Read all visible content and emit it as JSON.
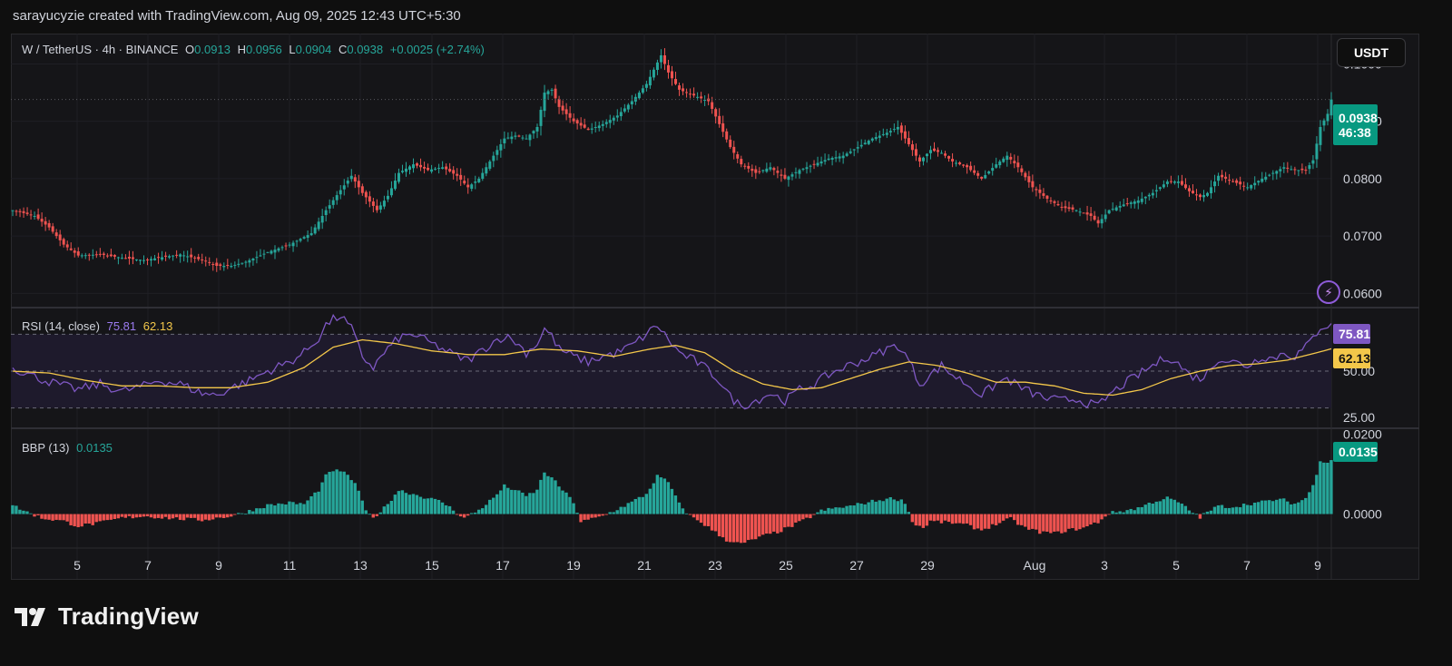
{
  "attribution": "sarayucyzie created with TradingView.com, Aug 09, 2025 12:43 UTC+5:30",
  "brand": "TradingView",
  "currency_button": "USDT",
  "flash_icon": "lightning-icon",
  "colors": {
    "up": "#26a69a",
    "down": "#ef5350",
    "rsi": "#7e57c2",
    "rsi_ma": "#f3c74a"
  },
  "legend": {
    "symbol": "W / TetherUS · 4h · BINANCE",
    "o_label": "O",
    "o": "0.0913",
    "h_label": "H",
    "h": "0.0956",
    "l_label": "L",
    "l": "0.0904",
    "c_label": "C",
    "c": "0.0938",
    "change": "+0.0025 (+2.74%)"
  },
  "price_tag": {
    "price": "0.0938",
    "countdown": "46:38"
  },
  "rsi_legend": {
    "label": "RSI (14, close)",
    "value": "75.81",
    "ma": "62.13"
  },
  "bbp_legend": {
    "label": "BBP (13)",
    "value": "0.0135"
  },
  "chart_data": [
    {
      "type": "candlestick",
      "series_name": "W / TetherUS",
      "x_ticks": [
        "5",
        "7",
        "9",
        "11",
        "13",
        "15",
        "17",
        "19",
        "21",
        "23",
        "25",
        "27",
        "29",
        "Aug",
        "3",
        "5",
        "7",
        "9"
      ],
      "y_ticks": [
        "0.1000",
        "0.0900",
        "0.0800",
        "0.0700",
        "0.0600"
      ],
      "ylim": [
        0.058,
        0.1045
      ],
      "last_price": 0.0938,
      "close_path": [
        [
          0,
          0.0745
        ],
        [
          6,
          0.0735
        ],
        [
          10,
          0.0715
        ],
        [
          14,
          0.0685
        ],
        [
          18,
          0.0666
        ],
        [
          24,
          0.0668
        ],
        [
          30,
          0.0662
        ],
        [
          36,
          0.0658
        ],
        [
          40,
          0.0662
        ],
        [
          46,
          0.0668
        ],
        [
          52,
          0.0658
        ],
        [
          56,
          0.0648
        ],
        [
          60,
          0.0648
        ],
        [
          64,
          0.0655
        ],
        [
          70,
          0.0672
        ],
        [
          76,
          0.0685
        ],
        [
          82,
          0.0705
        ],
        [
          86,
          0.0745
        ],
        [
          90,
          0.078
        ],
        [
          93,
          0.0805
        ],
        [
          96,
          0.0775
        ],
        [
          100,
          0.0745
        ],
        [
          103,
          0.077
        ],
        [
          106,
          0.081
        ],
        [
          110,
          0.0825
        ],
        [
          114,
          0.0815
        ],
        [
          118,
          0.082
        ],
        [
          122,
          0.0805
        ],
        [
          125,
          0.0785
        ],
        [
          128,
          0.08
        ],
        [
          132,
          0.084
        ],
        [
          135,
          0.087
        ],
        [
          138,
          0.0875
        ],
        [
          141,
          0.087
        ],
        [
          144,
          0.089
        ],
        [
          146,
          0.095
        ],
        [
          148,
          0.0955
        ],
        [
          150,
          0.0925
        ],
        [
          154,
          0.09
        ],
        [
          158,
          0.0885
        ],
        [
          162,
          0.0895
        ],
        [
          166,
          0.091
        ],
        [
          170,
          0.0935
        ],
        [
          174,
          0.0965
        ],
        [
          176,
          0.099
        ],
        [
          178,
          0.1015
        ],
        [
          180,
          0.0985
        ],
        [
          183,
          0.0955
        ],
        [
          187,
          0.0945
        ],
        [
          191,
          0.0935
        ],
        [
          194,
          0.0895
        ],
        [
          197,
          0.0855
        ],
        [
          200,
          0.0825
        ],
        [
          204,
          0.081
        ],
        [
          208,
          0.082
        ],
        [
          212,
          0.08
        ],
        [
          216,
          0.0815
        ],
        [
          220,
          0.0825
        ],
        [
          224,
          0.0835
        ],
        [
          228,
          0.084
        ],
        [
          232,
          0.0855
        ],
        [
          236,
          0.087
        ],
        [
          240,
          0.088
        ],
        [
          243,
          0.089
        ],
        [
          246,
          0.086
        ],
        [
          249,
          0.083
        ],
        [
          252,
          0.085
        ],
        [
          255,
          0.0845
        ],
        [
          258,
          0.083
        ],
        [
          262,
          0.082
        ],
        [
          266,
          0.08
        ],
        [
          270,
          0.0825
        ],
        [
          273,
          0.084
        ],
        [
          276,
          0.082
        ],
        [
          280,
          0.0785
        ],
        [
          284,
          0.0765
        ],
        [
          288,
          0.075
        ],
        [
          292,
          0.0745
        ],
        [
          296,
          0.0735
        ],
        [
          298,
          0.0722
        ],
        [
          301,
          0.0745
        ],
        [
          305,
          0.0755
        ],
        [
          309,
          0.0762
        ],
        [
          313,
          0.0775
        ],
        [
          317,
          0.0795
        ],
        [
          320,
          0.0795
        ],
        [
          323,
          0.0778
        ],
        [
          326,
          0.0768
        ],
        [
          328,
          0.0775
        ],
        [
          331,
          0.0805
        ],
        [
          335,
          0.0795
        ],
        [
          339,
          0.0785
        ],
        [
          343,
          0.08
        ],
        [
          346,
          0.081
        ],
        [
          349,
          0.082
        ],
        [
          352,
          0.0815
        ],
        [
          355,
          0.0815
        ],
        [
          357,
          0.0832
        ],
        [
          359,
          0.089
        ],
        [
          361,
          0.0913
        ],
        [
          362,
          0.0938
        ]
      ]
    },
    {
      "type": "line",
      "series_name": "RSI (14, close)",
      "ylim": [
        20,
        83
      ],
      "y_ticks": [
        "50.00",
        "25.00"
      ],
      "bands": [
        30,
        50,
        70
      ],
      "rsi_path": [
        [
          0,
          52
        ],
        [
          6,
          47
        ],
        [
          12,
          43
        ],
        [
          18,
          40
        ],
        [
          24,
          43
        ],
        [
          30,
          39
        ],
        [
          36,
          42
        ],
        [
          40,
          45
        ],
        [
          46,
          43
        ],
        [
          52,
          38
        ],
        [
          56,
          37
        ],
        [
          60,
          41
        ],
        [
          64,
          44
        ],
        [
          70,
          50
        ],
        [
          76,
          55
        ],
        [
          80,
          60
        ],
        [
          84,
          68
        ],
        [
          86,
          75
        ],
        [
          88,
          78
        ],
        [
          90,
          80
        ],
        [
          93,
          73
        ],
        [
          96,
          58
        ],
        [
          99,
          52
        ],
        [
          102,
          60
        ],
        [
          106,
          68
        ],
        [
          110,
          70
        ],
        [
          114,
          66
        ],
        [
          118,
          62
        ],
        [
          122,
          58
        ],
        [
          125,
          56
        ],
        [
          128,
          60
        ],
        [
          132,
          66
        ],
        [
          135,
          69
        ],
        [
          138,
          66
        ],
        [
          141,
          60
        ],
        [
          144,
          65
        ],
        [
          146,
          73
        ],
        [
          148,
          69
        ],
        [
          150,
          62
        ],
        [
          154,
          58
        ],
        [
          158,
          55
        ],
        [
          162,
          58
        ],
        [
          166,
          60
        ],
        [
          170,
          64
        ],
        [
          174,
          70
        ],
        [
          177,
          75
        ],
        [
          180,
          67
        ],
        [
          183,
          60
        ],
        [
          187,
          56
        ],
        [
          190,
          52
        ],
        [
          194,
          45
        ],
        [
          197,
          36
        ],
        [
          200,
          31
        ],
        [
          204,
          34
        ],
        [
          208,
          38
        ],
        [
          212,
          34
        ],
        [
          216,
          40
        ],
        [
          220,
          43
        ],
        [
          224,
          48
        ],
        [
          228,
          52
        ],
        [
          232,
          55
        ],
        [
          236,
          58
        ],
        [
          240,
          62
        ],
        [
          243,
          64
        ],
        [
          246,
          56
        ],
        [
          249,
          43
        ],
        [
          252,
          48
        ],
        [
          255,
          53
        ],
        [
          258,
          48
        ],
        [
          262,
          43
        ],
        [
          266,
          37
        ],
        [
          270,
          43
        ],
        [
          273,
          46
        ],
        [
          276,
          42
        ],
        [
          280,
          38
        ],
        [
          284,
          35
        ],
        [
          288,
          34
        ],
        [
          292,
          35
        ],
        [
          296,
          32
        ],
        [
          298,
          31
        ],
        [
          301,
          37
        ],
        [
          305,
          43
        ],
        [
          309,
          48
        ],
        [
          313,
          53
        ],
        [
          317,
          58
        ],
        [
          320,
          54
        ],
        [
          323,
          48
        ],
        [
          326,
          46
        ],
        [
          328,
          49
        ],
        [
          331,
          57
        ],
        [
          335,
          55
        ],
        [
          339,
          53
        ],
        [
          343,
          58
        ],
        [
          346,
          57
        ],
        [
          349,
          60
        ],
        [
          352,
          58
        ],
        [
          355,
          63
        ],
        [
          357,
          68
        ],
        [
          359,
          74
        ],
        [
          361,
          75
        ],
        [
          362,
          75.81
        ]
      ],
      "ma_path": [
        [
          0,
          50
        ],
        [
          10,
          49
        ],
        [
          20,
          45
        ],
        [
          30,
          42
        ],
        [
          40,
          42
        ],
        [
          50,
          41
        ],
        [
          60,
          41
        ],
        [
          70,
          44
        ],
        [
          80,
          52
        ],
        [
          88,
          63
        ],
        [
          96,
          67
        ],
        [
          105,
          65
        ],
        [
          115,
          61
        ],
        [
          125,
          59
        ],
        [
          135,
          59
        ],
        [
          145,
          62
        ],
        [
          155,
          61
        ],
        [
          165,
          58
        ],
        [
          175,
          62
        ],
        [
          182,
          64
        ],
        [
          190,
          60
        ],
        [
          198,
          50
        ],
        [
          206,
          43
        ],
        [
          214,
          40
        ],
        [
          222,
          41
        ],
        [
          230,
          46
        ],
        [
          238,
          51
        ],
        [
          246,
          55
        ],
        [
          254,
          53
        ],
        [
          262,
          49
        ],
        [
          270,
          44
        ],
        [
          278,
          44
        ],
        [
          286,
          42
        ],
        [
          294,
          38
        ],
        [
          302,
          37
        ],
        [
          310,
          40
        ],
        [
          318,
          46
        ],
        [
          326,
          50
        ],
        [
          334,
          53
        ],
        [
          342,
          54
        ],
        [
          350,
          56
        ],
        [
          358,
          60
        ],
        [
          362,
          62.13
        ]
      ]
    },
    {
      "type": "bar",
      "series_name": "BBP (13)",
      "ylim": [
        -0.0085,
        0.021
      ],
      "y_ticks": [
        "0.0200",
        "0.0000"
      ],
      "last_value": 0.0135,
      "bbp_path": [
        [
          0,
          0.0022
        ],
        [
          4,
          0.0005
        ],
        [
          8,
          -0.001
        ],
        [
          14,
          -0.0018
        ],
        [
          18,
          -0.003
        ],
        [
          24,
          -0.0022
        ],
        [
          30,
          -0.001
        ],
        [
          36,
          -0.0005
        ],
        [
          40,
          -0.0008
        ],
        [
          46,
          -0.0012
        ],
        [
          52,
          -0.0015
        ],
        [
          56,
          -0.001
        ],
        [
          60,
          -0.0005
        ],
        [
          64,
          0.0005
        ],
        [
          70,
          0.0022
        ],
        [
          76,
          0.0028
        ],
        [
          80,
          0.0025
        ],
        [
          84,
          0.006
        ],
        [
          86,
          0.0095
        ],
        [
          88,
          0.011
        ],
        [
          92,
          0.01
        ],
        [
          95,
          0.006
        ],
        [
          97,
          0.0005
        ],
        [
          99,
          -0.001
        ],
        [
          102,
          0.0015
        ],
        [
          106,
          0.006
        ],
        [
          110,
          0.005
        ],
        [
          114,
          0.004
        ],
        [
          118,
          0.003
        ],
        [
          121,
          0.001
        ],
        [
          124,
          -0.001
        ],
        [
          128,
          0.001
        ],
        [
          132,
          0.004
        ],
        [
          135,
          0.007
        ],
        [
          138,
          0.006
        ],
        [
          141,
          0.0045
        ],
        [
          144,
          0.006
        ],
        [
          146,
          0.0105
        ],
        [
          148,
          0.009
        ],
        [
          150,
          0.007
        ],
        [
          154,
          0.003
        ],
        [
          156,
          -0.002
        ],
        [
          158,
          -0.0015
        ],
        [
          162,
          -0.0005
        ],
        [
          166,
          0.0012
        ],
        [
          170,
          0.003
        ],
        [
          174,
          0.005
        ],
        [
          177,
          0.0095
        ],
        [
          180,
          0.008
        ],
        [
          183,
          0.0025
        ],
        [
          186,
          -0.0005
        ],
        [
          189,
          -0.002
        ],
        [
          192,
          -0.004
        ],
        [
          196,
          -0.0065
        ],
        [
          200,
          -0.0075
        ],
        [
          203,
          -0.0065
        ],
        [
          206,
          -0.0055
        ],
        [
          210,
          -0.0045
        ],
        [
          214,
          -0.003
        ],
        [
          218,
          -0.0012
        ],
        [
          222,
          0.0008
        ],
        [
          226,
          0.0015
        ],
        [
          230,
          0.002
        ],
        [
          234,
          0.0028
        ],
        [
          238,
          0.0035
        ],
        [
          242,
          0.004
        ],
        [
          245,
          0.003
        ],
        [
          247,
          -0.002
        ],
        [
          250,
          -0.0035
        ],
        [
          252,
          -0.0018
        ],
        [
          255,
          -0.002
        ],
        [
          258,
          -0.0022
        ],
        [
          262,
          -0.0028
        ],
        [
          266,
          -0.004
        ],
        [
          270,
          -0.0025
        ],
        [
          274,
          -0.0012
        ],
        [
          278,
          -0.0035
        ],
        [
          282,
          -0.0045
        ],
        [
          286,
          -0.0048
        ],
        [
          290,
          -0.004
        ],
        [
          294,
          -0.0035
        ],
        [
          298,
          -0.002
        ],
        [
          301,
          0.0002
        ],
        [
          305,
          0.0008
        ],
        [
          309,
          0.0015
        ],
        [
          313,
          0.003
        ],
        [
          317,
          0.004
        ],
        [
          320,
          0.003
        ],
        [
          323,
          0.001
        ],
        [
          326,
          -0.0008
        ],
        [
          328,
          0.0005
        ],
        [
          331,
          0.002
        ],
        [
          335,
          0.0018
        ],
        [
          339,
          0.0025
        ],
        [
          343,
          0.003
        ],
        [
          346,
          0.0035
        ],
        [
          349,
          0.0035
        ],
        [
          352,
          0.0025
        ],
        [
          355,
          0.004
        ],
        [
          357,
          0.007
        ],
        [
          359,
          0.0135
        ],
        [
          361,
          0.013
        ],
        [
          362,
          0.0135
        ]
      ]
    }
  ]
}
